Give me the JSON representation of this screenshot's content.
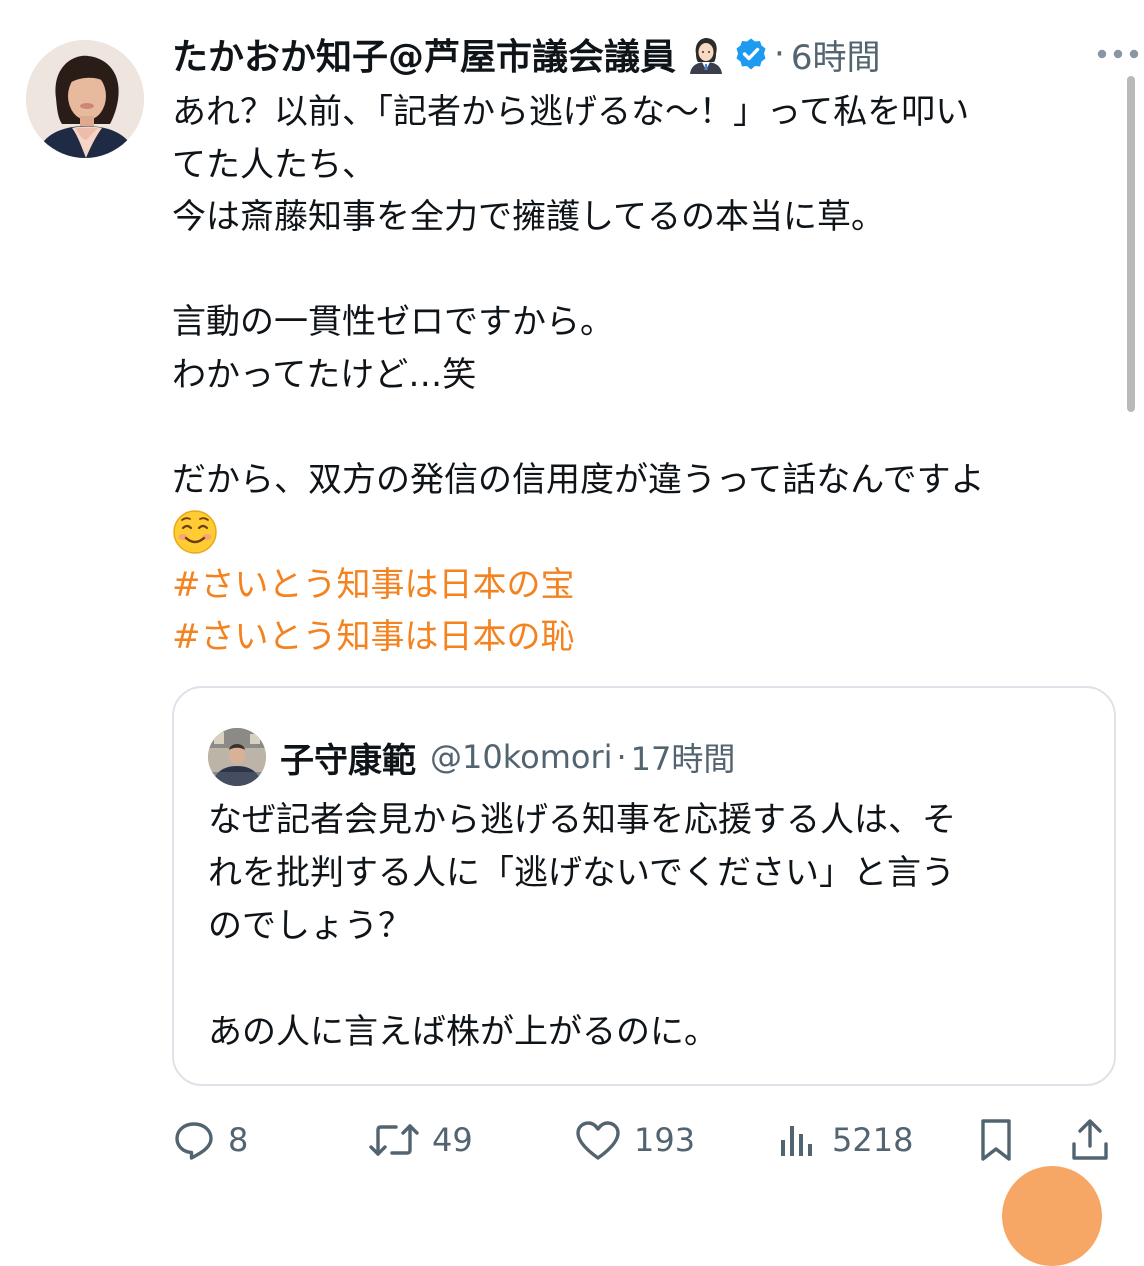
{
  "tweet": {
    "display_name": "たかおか知子@芦屋市議会議員",
    "role_emoji": "office-worker-woman-emoji",
    "verified_icon": "verified-badge-icon",
    "separator": "·",
    "timestamp": "6時間",
    "body_lines": [
      "あれ？以前、「記者から逃げるな〜！」って私を叩い",
      "てた人たち、",
      "今は斎藤知事を全力で擁護してるの本当に草。",
      "",
      "言動の一貫性ゼロですから。",
      "わかってたけど…笑",
      "",
      "だから、双方の発信の信用度が違うって話なんですよ"
    ],
    "emoji": "smiling-face-emoji",
    "hashtags": [
      "#さいとう知事は日本の宝",
      "#さいとう知事は日本の恥"
    ]
  },
  "quote": {
    "display_name": "子守康範",
    "handle": "@10komori",
    "separator": "·",
    "timestamp": "17時間",
    "body_lines": [
      "なぜ記者会見から逃げる知事を応援する人は、そ",
      "れを批判する人に「逃げないでください」と言う",
      "のでしょう？",
      "",
      "あの人に言えば株が上がるのに。"
    ]
  },
  "actions": {
    "reply": {
      "icon": "reply-icon",
      "count": "8"
    },
    "retweet": {
      "icon": "retweet-icon",
      "count": "49"
    },
    "like": {
      "icon": "heart-icon",
      "count": "193"
    },
    "views": {
      "icon": "views-icon",
      "count": "5218"
    },
    "bookmark": {
      "icon": "bookmark-icon"
    },
    "share": {
      "icon": "share-icon"
    }
  },
  "colors": {
    "text": "#0f1419",
    "secondary": "#536471",
    "hashtag": "#f3821f",
    "verified": "#1d9bf0",
    "border": "#dde3e8",
    "fab": "#f7a765"
  }
}
